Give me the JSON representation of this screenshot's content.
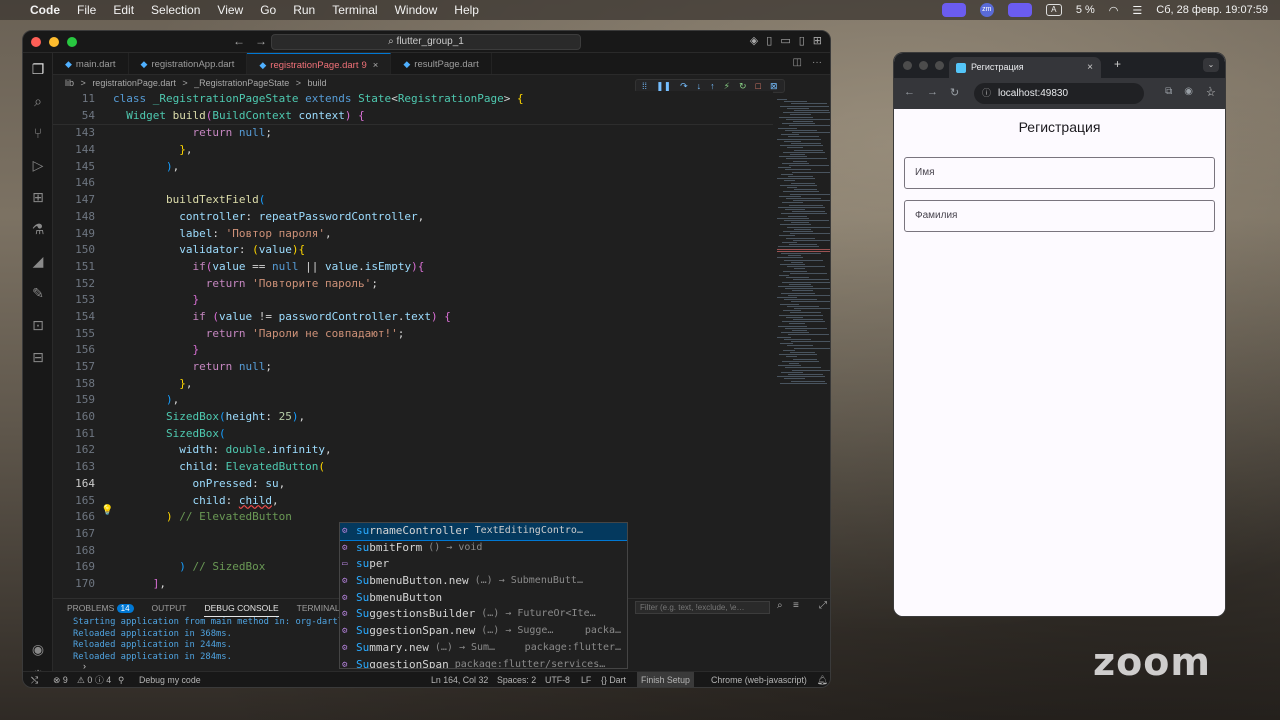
{
  "menubar": {
    "apple": "",
    "items": [
      "Code",
      "File",
      "Edit",
      "Selection",
      "View",
      "Go",
      "Run",
      "Terminal",
      "Window",
      "Help"
    ],
    "zm_badge": "zm",
    "input_source": "A",
    "battery": "5 %",
    "datetime": "Сб, 28 февр.  19:07:59"
  },
  "vscode": {
    "search_text": "flutter_group_1",
    "tabs": [
      {
        "label": "main.dart"
      },
      {
        "label": "registrationApp.dart"
      },
      {
        "label": "registrationPage.dart",
        "dirty": "9",
        "active": true
      },
      {
        "label": "resultPage.dart"
      }
    ],
    "breadcrumb": [
      "lib",
      ">",
      "registrationPage.dart",
      ">",
      "_RegistrationPageState",
      ">",
      "build"
    ],
    "sticky_lines": [
      {
        "n": "11",
        "html": "<span class='kw'>class</span> <span class='cls'>_RegistrationPageState</span> <span class='kw'>extends</span> <span class='cls'>State</span><span class='pun'>&lt;</span><span class='cls'>RegistrationPage</span><span class='pun'>&gt;</span> <span class='br1'>{</span>"
      },
      {
        "n": "54",
        "html": "  <span class='cls'>Widget</span> <span class='fn'>build</span><span class='br2'>(</span><span class='cls'>BuildContext</span> <span class='var'>context</span><span class='br2'>)</span> <span class='br2'>{</span>"
      }
    ],
    "code_lines": [
      {
        "n": "143",
        "html": "            <span class='kw2'>return</span> <span class='kw'>null</span>;"
      },
      {
        "n": "144",
        "html": "          <span class='br1'>}</span>,"
      },
      {
        "n": "145",
        "html": "        <span class='br3'>)</span>,"
      },
      {
        "n": "146",
        "html": ""
      },
      {
        "n": "147",
        "html": "        <span class='fn'>buildTextField</span><span class='br3'>(</span>"
      },
      {
        "n": "148",
        "html": "          <span class='var'>controller</span>: <span class='var'>repeatPasswordController</span>,"
      },
      {
        "n": "149",
        "html": "          <span class='var'>label</span>: <span class='str'>'Повтор пароля'</span>,"
      },
      {
        "n": "150",
        "html": "          <span class='var'>validator</span>: <span class='br1'>(</span><span class='var'>value</span><span class='br1'>)</span><span class='br1'>{</span>"
      },
      {
        "n": "151",
        "html": "            <span class='kw2'>if</span><span class='br2'>(</span><span class='var'>value</span> == <span class='kw'>null</span> || <span class='var'>value</span>.<span class='var'>isEmpty</span><span class='br2'>)</span><span class='br2'>{</span>"
      },
      {
        "n": "152",
        "html": "              <span class='kw2'>return</span> <span class='str'>'Повторите пароль'</span>;"
      },
      {
        "n": "153",
        "html": "            <span class='br2'>}</span>"
      },
      {
        "n": "154",
        "html": "            <span class='kw2'>if</span> <span class='br2'>(</span><span class='var'>value</span> != <span class='var'>passwordController</span>.<span class='var'>text</span><span class='br2'>)</span> <span class='br2'>{</span>"
      },
      {
        "n": "155",
        "html": "              <span class='kw2'>return</span> <span class='str'>'Пароли не совпадают!'</span>;"
      },
      {
        "n": "156",
        "html": "            <span class='br2'>}</span>"
      },
      {
        "n": "157",
        "html": "            <span class='kw2'>return</span> <span class='kw'>null</span>;"
      },
      {
        "n": "158",
        "html": "          <span class='br1'>}</span>,"
      },
      {
        "n": "159",
        "html": "        <span class='br3'>)</span>,"
      },
      {
        "n": "160",
        "html": "        <span class='cls'>SizedBox</span><span class='br3'>(</span><span class='var'>height</span>: <span style='color:#b5cea8'>25</span><span class='br3'>)</span>,"
      },
      {
        "n": "161",
        "html": "        <span class='cls'>SizedBox</span><span class='br3'>(</span>"
      },
      {
        "n": "162",
        "html": "          <span class='var'>width</span>: <span class='cls'>double</span>.<span class='var'>infinity</span>,"
      },
      {
        "n": "163",
        "html": "          <span class='var'>child</span>: <span class='cls'>ElevatedButton</span><span class='br1'>(</span>"
      },
      {
        "n": "164",
        "html": "            <span class='var'>onPressed</span>: <span class='var'>su</span>,",
        "current": true
      },
      {
        "n": "165",
        "html": "            <span class='var'>child</span>: <span class='var err'>child</span>,"
      },
      {
        "n": "166",
        "html": "        <span class='br1'>)</span> <span class='cm'>// ElevatedButton</span>"
      },
      {
        "n": "167",
        "html": ""
      },
      {
        "n": "168",
        "html": ""
      },
      {
        "n": "169",
        "html": "          <span class='br3'>)</span> <span class='cm'>// SizedBox</span>"
      },
      {
        "n": "170",
        "html": "      <span class='br2'>]</span>,"
      }
    ],
    "suggestions": [
      {
        "icon": "⚙",
        "match": "su",
        "rest": "rnameController",
        "detail": "TextEditingContro…",
        "pkg": "",
        "selected": true
      },
      {
        "icon": "⚙",
        "match": "su",
        "rest": "bmitForm",
        "detail": "() → void",
        "pkg": ""
      },
      {
        "icon": "▭",
        "match": "su",
        "rest": "per",
        "detail": "",
        "pkg": ""
      },
      {
        "icon": "⚙",
        "match": "Su",
        "rest": "bmenuButton.new",
        "detail": "(…) → SubmenuButt…",
        "pkg": ""
      },
      {
        "icon": "⚙",
        "match": "Su",
        "rest": "bmenuButton",
        "detail": "",
        "pkg": ""
      },
      {
        "icon": "⚙",
        "match": "Su",
        "rest": "ggestionsBuilder",
        "detail": "(…) → FutureOr<Ite…",
        "pkg": ""
      },
      {
        "icon": "⚙",
        "match": "Su",
        "rest": "ggestionSpan.new",
        "detail": "(…) → Sugge…",
        "pkg": "packa…"
      },
      {
        "icon": "⚙",
        "match": "Su",
        "rest": "mmary.new",
        "detail": "(…) → Sum…",
        "pkg": "package:flutter…"
      },
      {
        "icon": "⚙",
        "match": "Su",
        "rest": "ggestionSpan",
        "detail": "package:flutter/services…",
        "pkg": ""
      }
    ],
    "panel": {
      "tabs": [
        "PROBLEMS",
        "OUTPUT",
        "DEBUG CONSOLE",
        "TERMINAL"
      ],
      "problems_count": "14",
      "filter_placeholder": "Filter (e.g. text, !exclude, \\e…",
      "log": [
        "Starting application from main method in: org-dartl",
        "Reloaded application in 368ms.",
        "Reloaded application in 244ms.",
        "Reloaded application in 284ms."
      ]
    },
    "status": {
      "errors": "⊗ 9",
      "warnings": "⚠ 0",
      "info": "ⓘ 4",
      "debug": "Debug my code",
      "position": "Ln 164, Col 32",
      "spaces": "Spaces: 2",
      "encoding": "UTF-8",
      "eol": "LF",
      "language": "{} Dart",
      "finish": "Finish Setup",
      "device": "Chrome (web-javascript)"
    }
  },
  "chrome": {
    "tab_title": "Регистрация",
    "url": "localhost:49830",
    "page_title": "Регистрация",
    "fields": [
      "Имя",
      "Фамилия"
    ]
  },
  "zoom_watermark": "zoom"
}
